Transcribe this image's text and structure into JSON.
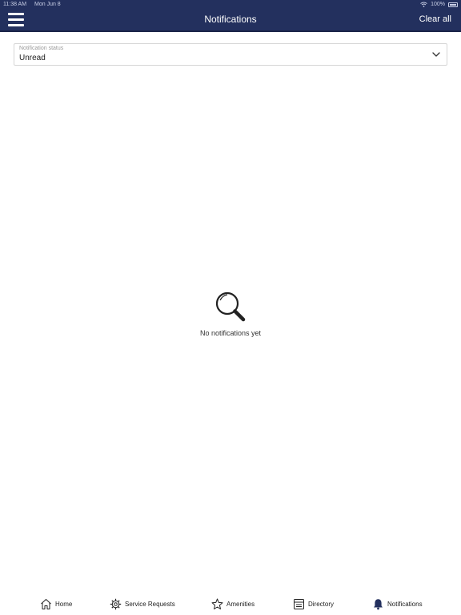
{
  "status_bar": {
    "time": "11:38 AM",
    "date": "Mon Jun 8",
    "battery": "100%"
  },
  "header": {
    "title": "Notifications",
    "clear_all": "Clear all",
    "menu_icon": "hamburger-icon"
  },
  "filter": {
    "label": "Notification status",
    "value": "Unread",
    "icon": "chevron-down-icon"
  },
  "empty_state": {
    "icon": "magnifier-icon",
    "message": "No notifications yet"
  },
  "tabs": [
    {
      "label": "Home",
      "icon": "home-icon"
    },
    {
      "label": "Service Requests",
      "icon": "gear-icon"
    },
    {
      "label": "Amenities",
      "icon": "star-icon"
    },
    {
      "label": "Directory",
      "icon": "directory-icon"
    },
    {
      "label": "Notifications",
      "icon": "bell-icon"
    }
  ],
  "colors": {
    "header_bg": "#23305e",
    "header_text": "#ffffff",
    "active_icon": "#23305e"
  }
}
